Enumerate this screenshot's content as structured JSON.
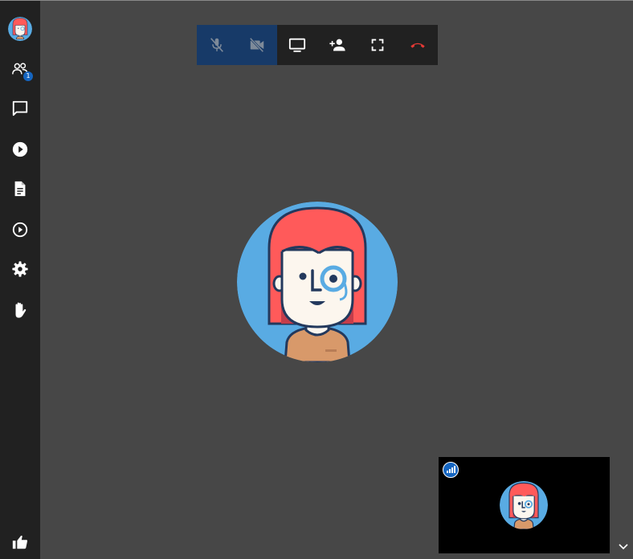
{
  "sidebar": {
    "participants_badge": "1",
    "items": [
      {
        "name": "participants",
        "icon": "people-icon"
      },
      {
        "name": "chat",
        "icon": "chat-icon"
      },
      {
        "name": "youtube",
        "icon": "play-circle-filled-icon"
      },
      {
        "name": "shared-document",
        "icon": "document-icon"
      },
      {
        "name": "recording",
        "icon": "play-circle-outline-icon"
      },
      {
        "name": "settings",
        "icon": "gear-icon"
      },
      {
        "name": "raise-hand",
        "icon": "hand-icon"
      },
      {
        "name": "feedback",
        "icon": "thumbs-up-icon"
      }
    ]
  },
  "toolbar": {
    "buttons": [
      {
        "name": "microphone",
        "icon": "mic-off-icon",
        "state": "muted"
      },
      {
        "name": "camera",
        "icon": "videocam-off-icon",
        "state": "off"
      },
      {
        "name": "screen-share",
        "icon": "monitor-icon"
      },
      {
        "name": "invite",
        "icon": "person-add-icon"
      },
      {
        "name": "fullscreen",
        "icon": "fullscreen-icon"
      },
      {
        "name": "hangup",
        "icon": "phone-hangup-icon"
      }
    ]
  },
  "colors": {
    "background": "#474747",
    "sidebar": "#212121",
    "toolbar_off": "#173a68",
    "hangup": "#e53935",
    "avatar_bg": "#59abe3",
    "hair": "#ff5a5a",
    "shirt": "#d8996a"
  }
}
